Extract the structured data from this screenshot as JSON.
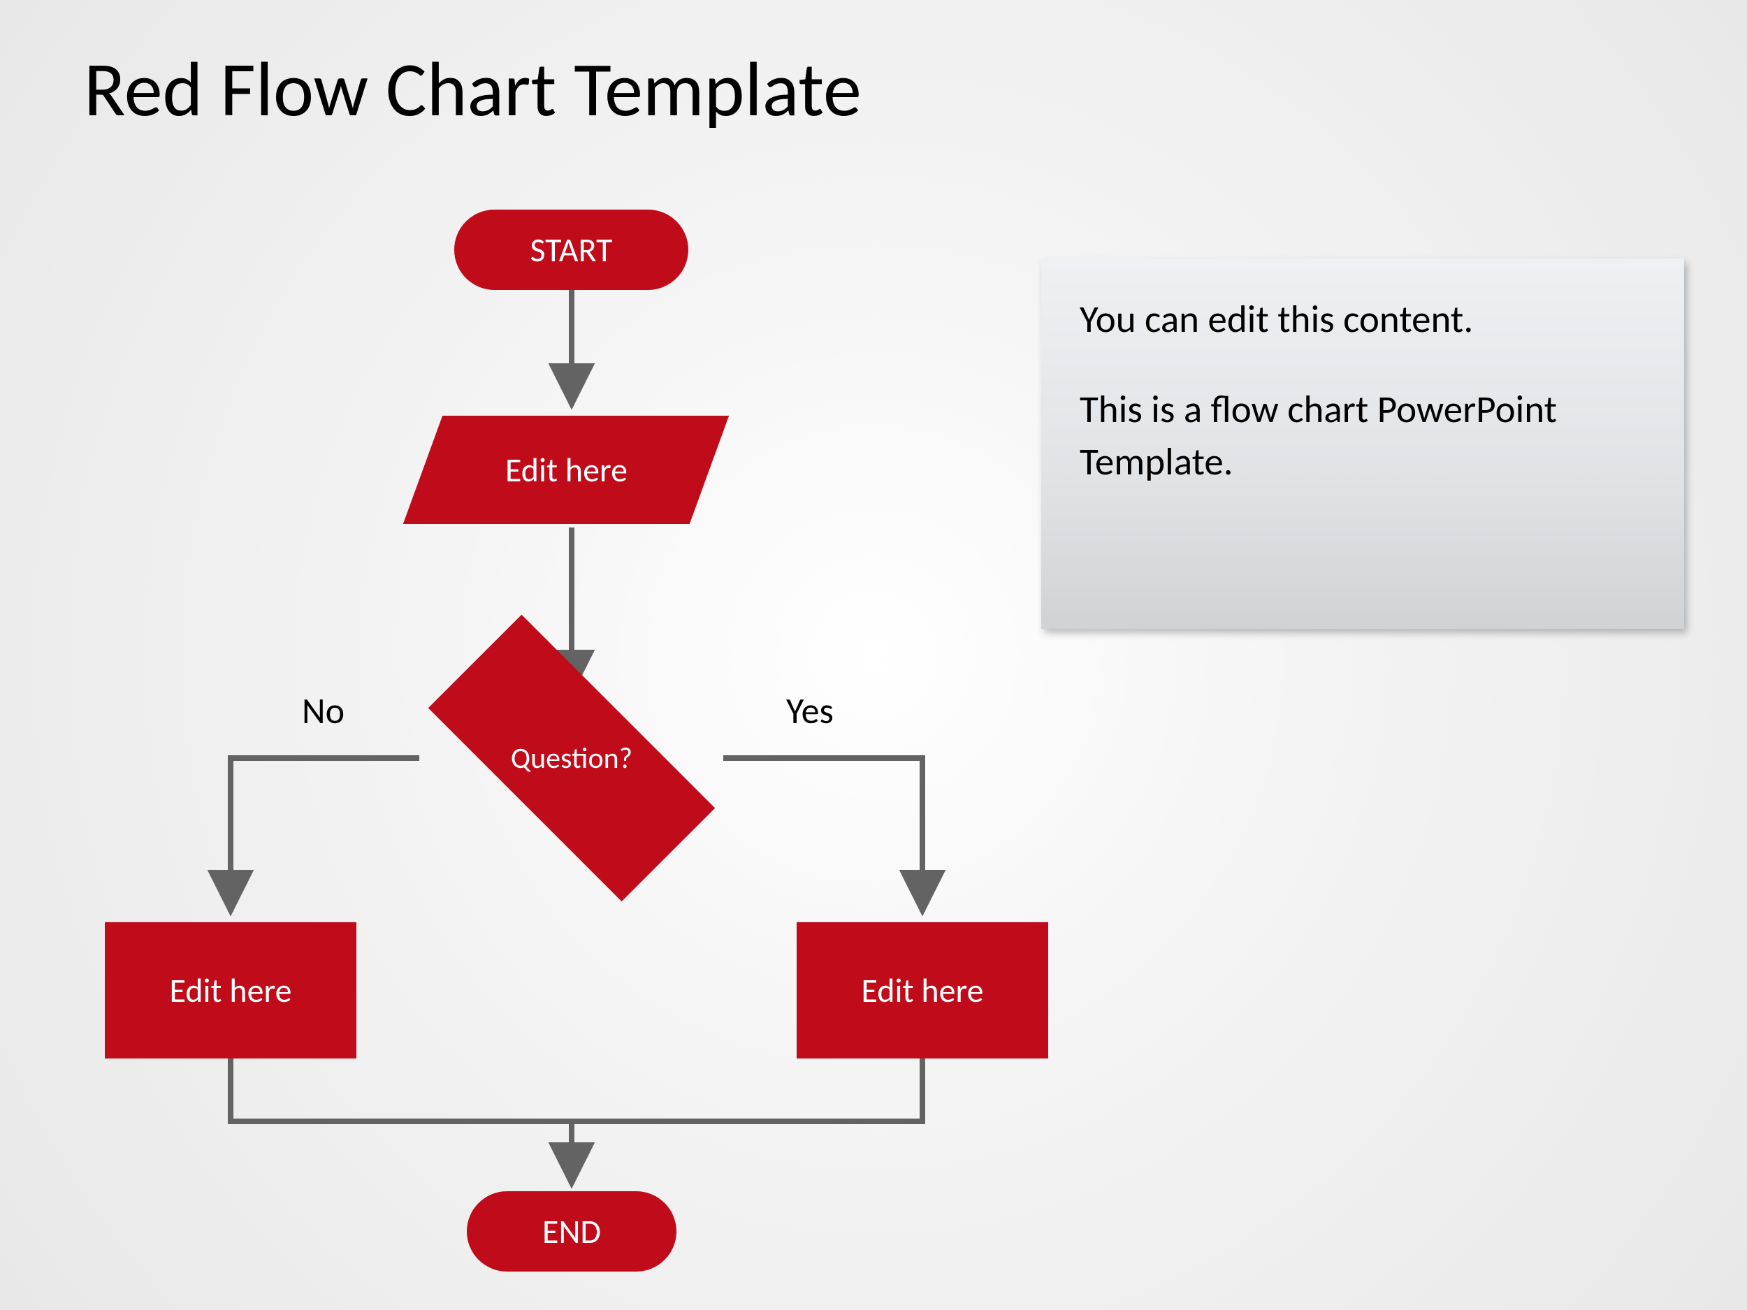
{
  "title": "Red Flow Chart Template",
  "callout": {
    "line1": "You can edit this content.",
    "line2": "This is a flow chart PowerPoint Template."
  },
  "flowchart": {
    "start": "START",
    "input": "Edit here",
    "decision": "Question?",
    "decision_no": "No",
    "decision_yes": "Yes",
    "process_left": "Edit here",
    "process_right": "Edit here",
    "end": "END"
  },
  "colors": {
    "shape_fill": "#C00B1A",
    "connector": "#636363",
    "background": "#eeeeee"
  }
}
